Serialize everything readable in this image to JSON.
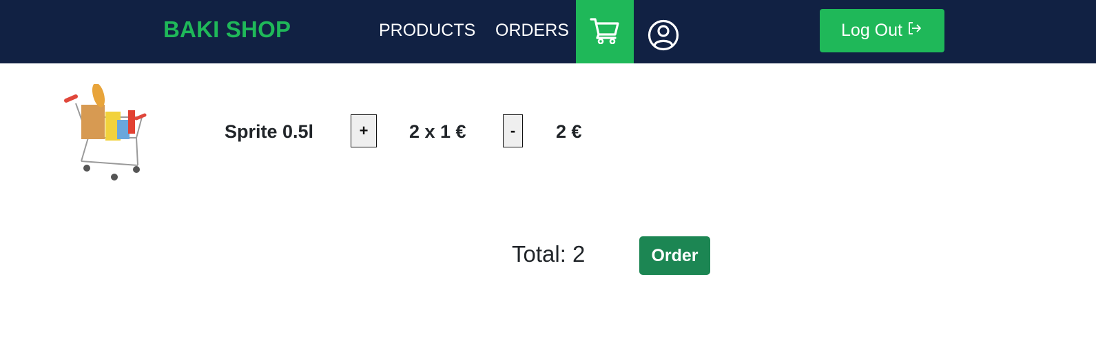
{
  "navbar": {
    "brand": "BAKI SHOP",
    "links": [
      {
        "label": "PRODUCTS"
      },
      {
        "label": "ORDERS"
      }
    ],
    "cart_icon": "cart-icon",
    "account_icon": "user-circle-icon",
    "logout": {
      "label": "Log Out",
      "icon": "logout-arrow-icon"
    }
  },
  "cart": {
    "items": [
      {
        "image": "shopping-cart-with-groceries",
        "name": "Sprite 0.5l",
        "plus_label": "+",
        "qty_price": "2 x 1 €",
        "minus_label": "-",
        "subtotal": "2 €"
      }
    ],
    "total_label": "Total: 2",
    "order_label": "Order"
  },
  "colors": {
    "navbar_bg": "#112143",
    "accent_green": "#1fb859",
    "order_button": "#1c8653"
  }
}
